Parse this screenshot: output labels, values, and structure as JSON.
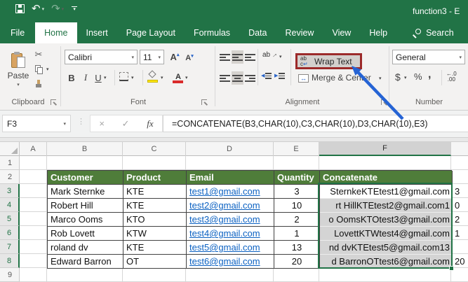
{
  "titlebar": {
    "title": "function3 - E",
    "qat": {
      "save": "save",
      "undo": "undo",
      "redo": "redo",
      "customize": "customize-quick-access-toolbar"
    }
  },
  "tabs": {
    "items": [
      {
        "label": "File"
      },
      {
        "label": "Home",
        "active": true
      },
      {
        "label": "Insert"
      },
      {
        "label": "Page Layout"
      },
      {
        "label": "Formulas"
      },
      {
        "label": "Data"
      },
      {
        "label": "Review"
      },
      {
        "label": "View"
      },
      {
        "label": "Help"
      }
    ],
    "search_label": "Search"
  },
  "ribbon": {
    "clipboard": {
      "paste_label": "Paste",
      "group_label": "Clipboard"
    },
    "font": {
      "font_name": "Calibri",
      "font_size": "11",
      "bold": "B",
      "italic": "I",
      "underline": "U",
      "group_label": "Font"
    },
    "alignment": {
      "wrap_text_label": "Wrap Text",
      "merge_center_label": "Merge & Center",
      "group_label": "Alignment"
    },
    "number": {
      "format": "General",
      "currency": "$",
      "percent": "%",
      "comma": ",",
      "inc_decimal_top": "←.0",
      "inc_decimal_bottom": ".00",
      "group_label": "Number"
    }
  },
  "formula_bar": {
    "name_box": "F3",
    "fx_label": "fx",
    "formula": "=CONCATENATE(B3,CHAR(10),C3,CHAR(10),D3,CHAR(10),E3)"
  },
  "sheet": {
    "col_headers": [
      "A",
      "B",
      "C",
      "D",
      "E",
      "F"
    ],
    "row_headers": [
      "1",
      "2",
      "3",
      "4",
      "5",
      "6",
      "7",
      "8",
      "9"
    ],
    "selected_range": "F3:F8",
    "table": {
      "headers": [
        "Customer",
        "Product",
        "Email",
        "Quantity",
        "Concatenate"
      ],
      "rows": [
        {
          "customer": "Mark Sternke",
          "product": "KTE",
          "email": "test1@gmail.com",
          "quantity": "3",
          "concat_visible": "SternkeKTEtest1@gmail.com",
          "concat_spill": "3"
        },
        {
          "customer": "Robert Hill",
          "product": "KTE",
          "email": "test2@gmail.com",
          "quantity": "10",
          "concat_visible": "rt HillKTEtest2@gmail.com1",
          "concat_spill": "0"
        },
        {
          "customer": "Marco Ooms",
          "product": "KTO",
          "email": "test3@gmail.com",
          "quantity": "2",
          "concat_visible": "o OomsKTOtest3@gmail.com",
          "concat_spill": "2"
        },
        {
          "customer": "Rob Lovett",
          "product": "KTW",
          "email": "test4@gmail.com",
          "quantity": "1",
          "concat_visible": "LovettKTWtest4@gmail.com",
          "concat_spill": "1"
        },
        {
          "customer": "roland dv",
          "product": "KTE",
          "email": "test5@gmail.com",
          "quantity": "13",
          "concat_visible": "nd dvKTEtest5@gmail.com13",
          "concat_spill": ""
        },
        {
          "customer": "Edward Barron",
          "product": "OT",
          "email": "test6@gmail.com",
          "quantity": "20",
          "concat_visible": "d BarronOTtest6@gmail.com",
          "concat_spill": "20"
        }
      ]
    }
  },
  "colors": {
    "excel_green": "#217346",
    "table_header_green": "#4f7d3a",
    "highlight_red": "#9c2a2a",
    "arrow_blue": "#2563d4",
    "link_blue": "#0b61c2",
    "selection_gray": "#d4d4d4"
  }
}
